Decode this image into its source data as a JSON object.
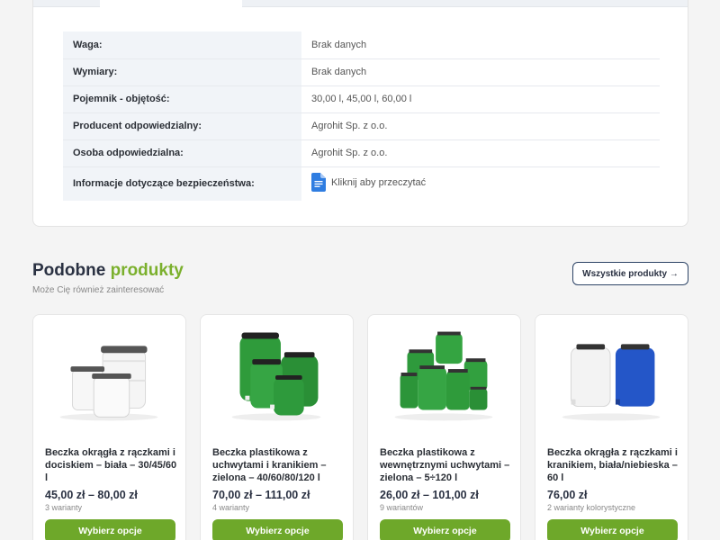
{
  "specs": [
    {
      "label": "Waga:",
      "value": "Brak danych"
    },
    {
      "label": "Wymiary:",
      "value": "Brak danych"
    },
    {
      "label": "Pojemnik - objętość:",
      "value": "30,00 l, 45,00 l, 60,00 l"
    },
    {
      "label": "Producent odpowiedzialny:",
      "value": "Agrohit Sp. z o.o."
    },
    {
      "label": "Osoba odpowiedzialna:",
      "value": "Agrohit Sp. z o.o."
    },
    {
      "label": "Informacje dotyczące bezpieczeństwa:",
      "value": "Kliknij aby przeczytać",
      "icon": "google-docs-icon"
    }
  ],
  "similar": {
    "title_main": "Podobne",
    "title_accent": "produkty",
    "subtitle": "Może Cię również zainteresować",
    "all_button": "Wszystkie produkty →"
  },
  "products": [
    {
      "name": "Beczka okrągła z rączkami i dociskiem – biała – 30/45/60 l",
      "price": "45,00 zł – 80,00 zł",
      "variants": "3 warianty",
      "button": "Wybierz opcje"
    },
    {
      "name": "Beczka plastikowa z uchwytami i kranikiem – zielona – 40/60/80/120 l",
      "price": "70,00 zł – 111,00 zł",
      "variants": "4 warianty",
      "button": "Wybierz opcje"
    },
    {
      "name": "Beczka plastikowa z wewnętrznymi uchwytami – zielona – 5÷120 l",
      "price": "26,00 zł – 101,00 zł",
      "variants": "9 wariantów",
      "button": "Wybierz opcje"
    },
    {
      "name": "Beczka okrągła z rączkami i kranikiem, biała/niebieska – 60 l",
      "price": "76,00 zł",
      "variants": "2 warianty kolorystyczne",
      "button": "Wybierz opcje"
    }
  ],
  "colors": {
    "accent_green": "#7bb02d",
    "button_green": "#6ea82a",
    "navy": "#2a3142",
    "doc_blue": "#2f7de1"
  }
}
